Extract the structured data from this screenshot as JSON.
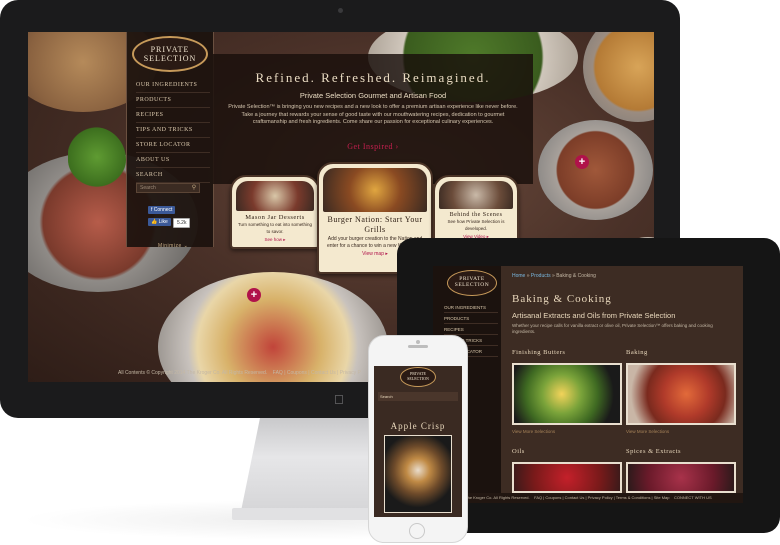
{
  "imac": {
    "logo_line1": "PRIVATE",
    "logo_line2": "SELECTION",
    "nav": [
      "Our Ingredients",
      "Products",
      "Recipes",
      "Tips and Tricks",
      "Store Locator",
      "About Us",
      "Search"
    ],
    "search_placeholder": "Search",
    "facebook_connect": "Connect",
    "facebook_like": "Like",
    "facebook_count": "5.2k",
    "minimize": "Minimize",
    "hero_title": "Refined. Refreshed. Reimagined.",
    "hero_subtitle": "Private Selection Gourmet and Artisan Food",
    "hero_body": "Private Selection™ is bringing you new recipes and a new look to offer a premium artisan experience like never before. Take a journey that rewards your sense of good taste with our mouthwatering recipes, dedication to gourmet craftsmanship and fresh ingredients. Come share our passion for exceptional culinary experiences.",
    "get_inspired": "Get Inspired ›",
    "cards": [
      {
        "title": "Mason Jar Desserts",
        "desc": "Turn something to eat into something to savor.",
        "link": "See how ▸"
      },
      {
        "title": "Burger Nation: Start Your Grills",
        "desc": "Add your burger creation to the Nation and enter for a chance to win a new Weber grill.",
        "link": "View map ▸"
      },
      {
        "title": "Behind the Scenes",
        "desc": "See how Private Selection is developed.",
        "link": "View Video ▸"
      }
    ],
    "footer": "All Contents © Copyright 2014 The Kroger Co. All Rights Reserved.",
    "footer_links": "FAQ  |  Coupons  |  Contact Us  |  Privacy P"
  },
  "ipad": {
    "logo_line1": "PRIVATE",
    "logo_line2": "SELECTION",
    "nav": [
      "Our Ingredients",
      "Products",
      "Recipes",
      "Tips and Tricks",
      "Store Locator"
    ],
    "breadcrumb": {
      "home": "Home",
      "sep": " » ",
      "products": "Products",
      "current": "Baking & Cooking"
    },
    "title": "Baking & Cooking",
    "subtitle": "Artisanal Extracts and Oils from Private Selection",
    "body": "Whether your recipe calls for vanilla extract or olive oil, Private Selection™ offers baking and cooking ingredients.",
    "sections": [
      {
        "title": "Finishing Butters",
        "more": "View More Selections"
      },
      {
        "title": "Baking",
        "more": "View More Selections"
      },
      {
        "title": "Oils"
      },
      {
        "title": "Spices & Extracts"
      }
    ],
    "footer": "Copyright 2014 The Kroger Co. All Rights Reserved.",
    "footer_links": "FAQ  |  Coupons  |  Contact Us  |  Privacy Policy  |  Terms & Conditions  |  Site Map",
    "footer_right": "CONNECT WITH US"
  },
  "iphone": {
    "logo_line1": "PRIVATE",
    "logo_line2": "SELECTION",
    "bar_text": "Search",
    "title": "Apple Crisp"
  },
  "colors": {
    "accent": "#b0124a",
    "gold": "#c79a5a",
    "cream": "#ead9bd"
  }
}
